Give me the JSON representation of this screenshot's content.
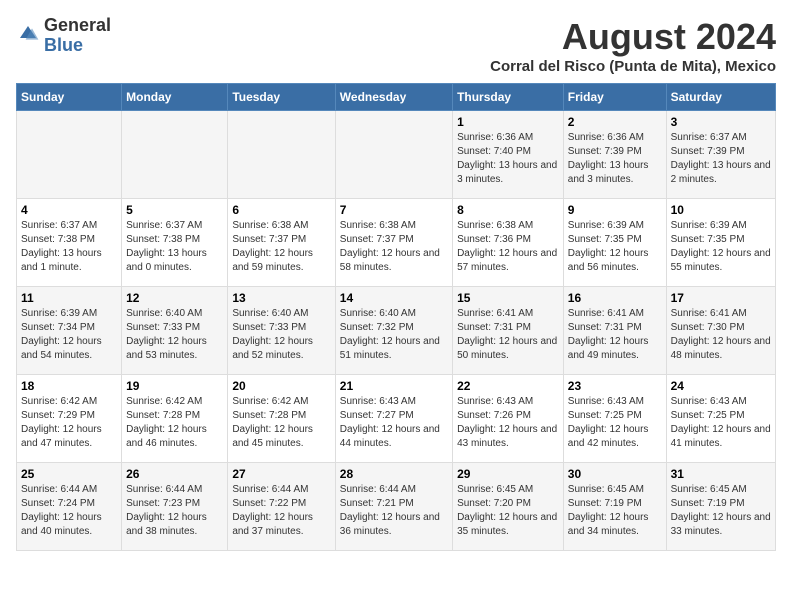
{
  "logo": {
    "general": "General",
    "blue": "Blue"
  },
  "title": "August 2024",
  "subtitle": "Corral del Risco (Punta de Mita), Mexico",
  "days_of_week": [
    "Sunday",
    "Monday",
    "Tuesday",
    "Wednesday",
    "Thursday",
    "Friday",
    "Saturday"
  ],
  "weeks": [
    [
      {
        "day": "",
        "info": ""
      },
      {
        "day": "",
        "info": ""
      },
      {
        "day": "",
        "info": ""
      },
      {
        "day": "",
        "info": ""
      },
      {
        "day": "1",
        "info": "Sunrise: 6:36 AM\nSunset: 7:40 PM\nDaylight: 13 hours and 3 minutes."
      },
      {
        "day": "2",
        "info": "Sunrise: 6:36 AM\nSunset: 7:39 PM\nDaylight: 13 hours and 3 minutes."
      },
      {
        "day": "3",
        "info": "Sunrise: 6:37 AM\nSunset: 7:39 PM\nDaylight: 13 hours and 2 minutes."
      }
    ],
    [
      {
        "day": "4",
        "info": "Sunrise: 6:37 AM\nSunset: 7:38 PM\nDaylight: 13 hours and 1 minute."
      },
      {
        "day": "5",
        "info": "Sunrise: 6:37 AM\nSunset: 7:38 PM\nDaylight: 13 hours and 0 minutes."
      },
      {
        "day": "6",
        "info": "Sunrise: 6:38 AM\nSunset: 7:37 PM\nDaylight: 12 hours and 59 minutes."
      },
      {
        "day": "7",
        "info": "Sunrise: 6:38 AM\nSunset: 7:37 PM\nDaylight: 12 hours and 58 minutes."
      },
      {
        "day": "8",
        "info": "Sunrise: 6:38 AM\nSunset: 7:36 PM\nDaylight: 12 hours and 57 minutes."
      },
      {
        "day": "9",
        "info": "Sunrise: 6:39 AM\nSunset: 7:35 PM\nDaylight: 12 hours and 56 minutes."
      },
      {
        "day": "10",
        "info": "Sunrise: 6:39 AM\nSunset: 7:35 PM\nDaylight: 12 hours and 55 minutes."
      }
    ],
    [
      {
        "day": "11",
        "info": "Sunrise: 6:39 AM\nSunset: 7:34 PM\nDaylight: 12 hours and 54 minutes."
      },
      {
        "day": "12",
        "info": "Sunrise: 6:40 AM\nSunset: 7:33 PM\nDaylight: 12 hours and 53 minutes."
      },
      {
        "day": "13",
        "info": "Sunrise: 6:40 AM\nSunset: 7:33 PM\nDaylight: 12 hours and 52 minutes."
      },
      {
        "day": "14",
        "info": "Sunrise: 6:40 AM\nSunset: 7:32 PM\nDaylight: 12 hours and 51 minutes."
      },
      {
        "day": "15",
        "info": "Sunrise: 6:41 AM\nSunset: 7:31 PM\nDaylight: 12 hours and 50 minutes."
      },
      {
        "day": "16",
        "info": "Sunrise: 6:41 AM\nSunset: 7:31 PM\nDaylight: 12 hours and 49 minutes."
      },
      {
        "day": "17",
        "info": "Sunrise: 6:41 AM\nSunset: 7:30 PM\nDaylight: 12 hours and 48 minutes."
      }
    ],
    [
      {
        "day": "18",
        "info": "Sunrise: 6:42 AM\nSunset: 7:29 PM\nDaylight: 12 hours and 47 minutes."
      },
      {
        "day": "19",
        "info": "Sunrise: 6:42 AM\nSunset: 7:28 PM\nDaylight: 12 hours and 46 minutes."
      },
      {
        "day": "20",
        "info": "Sunrise: 6:42 AM\nSunset: 7:28 PM\nDaylight: 12 hours and 45 minutes."
      },
      {
        "day": "21",
        "info": "Sunrise: 6:43 AM\nSunset: 7:27 PM\nDaylight: 12 hours and 44 minutes."
      },
      {
        "day": "22",
        "info": "Sunrise: 6:43 AM\nSunset: 7:26 PM\nDaylight: 12 hours and 43 minutes."
      },
      {
        "day": "23",
        "info": "Sunrise: 6:43 AM\nSunset: 7:25 PM\nDaylight: 12 hours and 42 minutes."
      },
      {
        "day": "24",
        "info": "Sunrise: 6:43 AM\nSunset: 7:25 PM\nDaylight: 12 hours and 41 minutes."
      }
    ],
    [
      {
        "day": "25",
        "info": "Sunrise: 6:44 AM\nSunset: 7:24 PM\nDaylight: 12 hours and 40 minutes."
      },
      {
        "day": "26",
        "info": "Sunrise: 6:44 AM\nSunset: 7:23 PM\nDaylight: 12 hours and 38 minutes."
      },
      {
        "day": "27",
        "info": "Sunrise: 6:44 AM\nSunset: 7:22 PM\nDaylight: 12 hours and 37 minutes."
      },
      {
        "day": "28",
        "info": "Sunrise: 6:44 AM\nSunset: 7:21 PM\nDaylight: 12 hours and 36 minutes."
      },
      {
        "day": "29",
        "info": "Sunrise: 6:45 AM\nSunset: 7:20 PM\nDaylight: 12 hours and 35 minutes."
      },
      {
        "day": "30",
        "info": "Sunrise: 6:45 AM\nSunset: 7:19 PM\nDaylight: 12 hours and 34 minutes."
      },
      {
        "day": "31",
        "info": "Sunrise: 6:45 AM\nSunset: 7:19 PM\nDaylight: 12 hours and 33 minutes."
      }
    ]
  ],
  "colors": {
    "header_bg": "#3a6ea5",
    "header_text": "#ffffff",
    "row_odd_bg": "#f5f5f5",
    "row_even_bg": "#ffffff"
  }
}
